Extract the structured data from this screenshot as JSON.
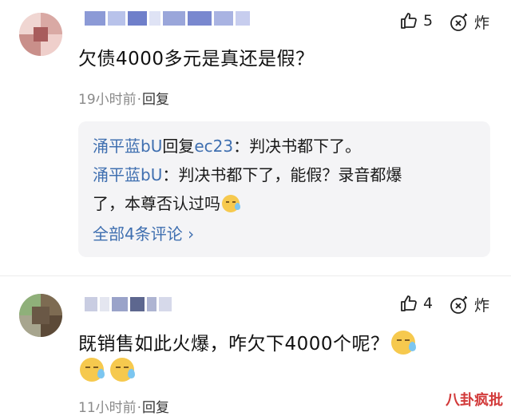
{
  "comments": [
    {
      "likes": "5",
      "blast_label": "炸",
      "text": "欠债4000多元是真还是假？",
      "time": "19小时前",
      "separator": "·",
      "reply_label": "回复",
      "replies": [
        {
          "user": "涌平蓝bU",
          "mid": "回复",
          "target": "ec23",
          "colon": "：",
          "text": "判决书都下了。"
        },
        {
          "user": "涌平蓝bU",
          "colon": "：",
          "text_line1": "判决书都下了，能假？录音都爆",
          "text_line2": "了，本尊否认过吗"
        }
      ],
      "view_all": "全部4条评论 ›"
    },
    {
      "likes": "4",
      "blast_label": "炸",
      "text": "既销售如此火爆，咋欠下4000个呢？",
      "time": "11小时前",
      "separator": "·",
      "reply_label": "回复"
    }
  ],
  "watermark": "八卦疯批",
  "icons": {
    "like": "thumbs-up-icon",
    "blast": "bomb-icon",
    "emoji": "sweat-smile-emoji-icon"
  },
  "colors": {
    "link_blue": "#3f6fb0",
    "reply_bg": "#f4f4f6",
    "watermark_red": "#d23a3a"
  }
}
